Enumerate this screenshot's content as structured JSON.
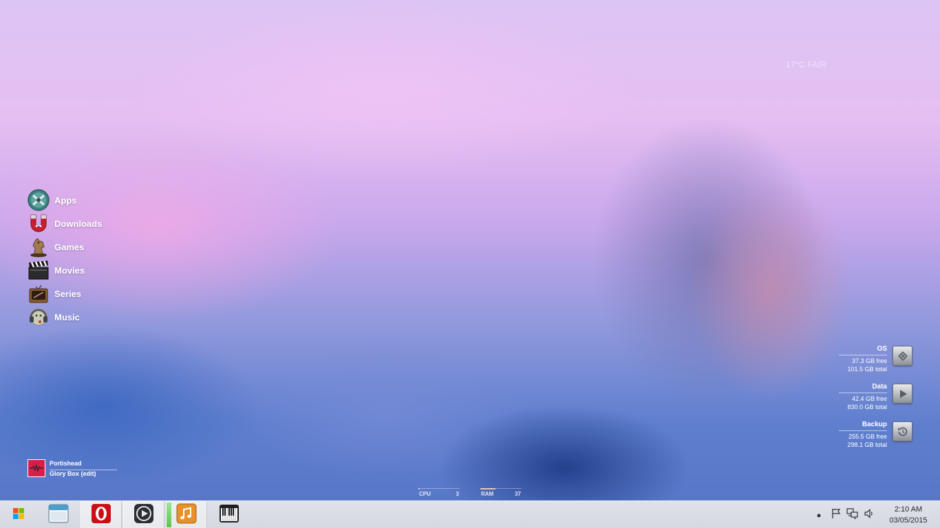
{
  "weather": {
    "text": "17°C FAIR"
  },
  "shortcuts": [
    {
      "label": "Apps",
      "icon": "apps-icon"
    },
    {
      "label": "Downloads",
      "icon": "magnet-icon"
    },
    {
      "label": "Games",
      "icon": "chess-knight-icon"
    },
    {
      "label": "Movies",
      "icon": "clapperboard-icon"
    },
    {
      "label": "Series",
      "icon": "retro-tv-icon"
    },
    {
      "label": "Music",
      "icon": "headphones-icon"
    }
  ],
  "drives": [
    {
      "name": "OS",
      "free": "37.3 GB free",
      "total": "101.5 GB total",
      "icon": "windows-drive-icon"
    },
    {
      "name": "Data",
      "free": "42.4 GB free",
      "total": "830.0 GB total",
      "icon": "media-drive-icon"
    },
    {
      "name": "Backup",
      "free": "255.5 GB free",
      "total": "298.1 GB total",
      "icon": "backup-drive-icon"
    }
  ],
  "now_playing": {
    "artist": "Portishead",
    "track": "Glory Box (edit)"
  },
  "meters": {
    "cpu": {
      "label": "CPU",
      "value": "3"
    },
    "ram": {
      "label": "RAM",
      "value": "37"
    }
  },
  "taskbar": {
    "items": [
      {
        "name": "start",
        "icon": "windows-logo-icon"
      },
      {
        "name": "file-explorer",
        "icon": "window-icon"
      },
      {
        "name": "opera",
        "icon": "opera-icon"
      },
      {
        "name": "media-player",
        "icon": "play-circle-icon"
      },
      {
        "name": "itunes",
        "icon": "music-note-icon"
      },
      {
        "name": "piano",
        "icon": "piano-keys-icon"
      }
    ],
    "tray": {
      "icons": [
        "dot-icon",
        "flag-icon",
        "network-icon",
        "speaker-icon"
      ]
    },
    "clock": {
      "time": "2:10 AM",
      "date": "03/05/2015"
    }
  },
  "colors": {
    "opera_red": "#cc0f16",
    "itunes_orange": "#e8902a",
    "taskbar_bg": "#d8dce2"
  }
}
